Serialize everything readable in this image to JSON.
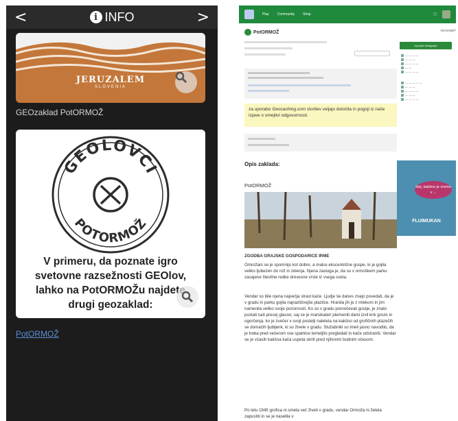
{
  "phone": {
    "back_glyph": "<",
    "forward_glyph": ">",
    "title": "INFO",
    "banner_logo": "JERUZALEM",
    "banner_sub": "SLOVENIA",
    "subtitle": "GEOzaklad PotORMOŽ",
    "stamp_top": "GEOLOVCI",
    "stamp_bottom": "POTORMOŽ",
    "card_text": "V primeru, da poznate igro svetovne razsežnosti GEOlov, lahko na PotORMOŽu najdete drugi geozaklad:",
    "link_text": "PotORMOŽ"
  },
  "page": {
    "nav": [
      "Play",
      "Community",
      "Shop"
    ],
    "user": "GCAHQNT",
    "cache_name": "PotORMOŽ",
    "warning": "za uporabo Geocaching.com storitev veljajo določila in pogoji iz naše izjave o omejitvi odgovornosti.",
    "desc_heading": "Opis zaklada:",
    "name_heading": "PotORMOŽ",
    "story_title": "ZGODBA GRAJSKE GOSPODARICE IRME",
    "para1": "Omrožani se je spomnijo kot dobre, a malce ekscentrične gospe, ki je gojila veliko ljubezen do rož in zelenja. Njena zasluga je, da so v ormoškem parku zasajene številne redke drevesne vrste iz vsega sveta.",
    "para2": "Vendar so bile njena največja strast kače. Ljudje še danes znajo povedati, da je v gradu in parku gojila najrazličnejše plazilce. Hranila jih je z mlekom in jim namenila veliko svoje pozornosti. Ko so v gradu prenočevali gostje, je znalo postati tudi precej glasno, saj se je marsikateri plemeniti dami izvil krik groze in ogorčenja, ko je zvečer v svoji postelji naletela na kakšno od grofičinih plazečih se domačih ljubljenk, ki so živele v gradu. Služabniki so imeli jasno navodilo, da je treba pred večerom vse spalnice temeljito pregledati in kače odstraniti. Vendar se je včasih kakšna kača uspela skriti pred njihovim budnim očesom.",
    "para3": "Po letu 1945 grofica ni smela več živeti v gradu, vendar Ormoža ni želela zapustiti in se je naselila v",
    "side_button": "Uporabi navigacijo",
    "ad_text": "Hej, kakšno je vreme v ...",
    "ad_brand": "FLUIMUKAN"
  },
  "colors": {
    "gc_green": "#1f8a3c",
    "banner_orange": "#c3773a",
    "link_blue": "#5b8fd6"
  }
}
